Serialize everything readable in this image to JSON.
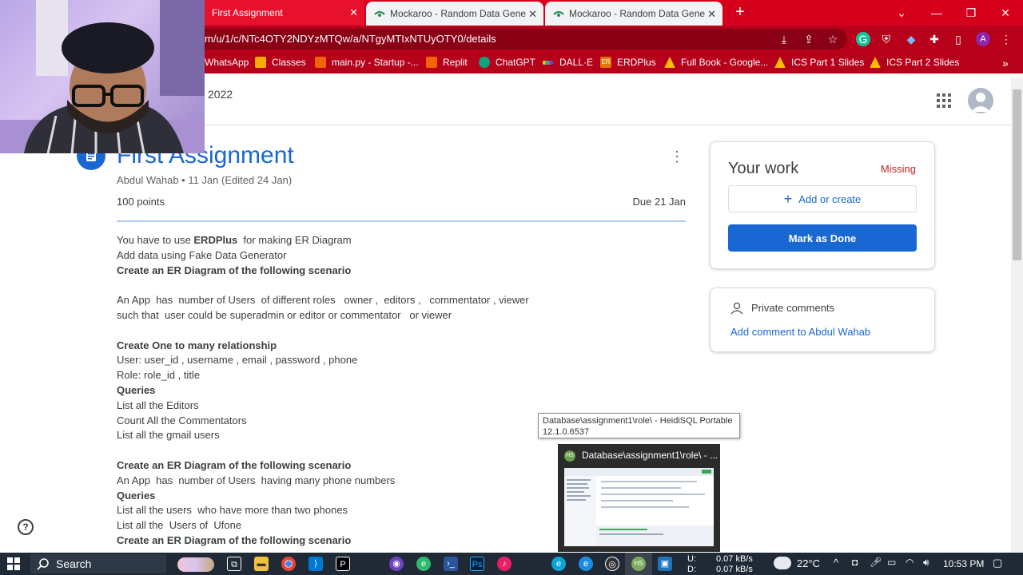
{
  "browser": {
    "tabs": [
      {
        "title": "First Assignment",
        "active": true
      },
      {
        "title": "Mockaroo - Random Data Gener",
        "active": false
      },
      {
        "title": "Mockaroo - Random Data Gener",
        "active": false
      }
    ],
    "new_tab": "+",
    "url": "m/u/1/c/NTc4OTY2NDYzMTQw/a/NTgyMTIxNTUyOTY0/details",
    "profile_initial": "A",
    "bookmarks": [
      {
        "label": "WhatsApp",
        "color": "#25d366"
      },
      {
        "label": "Classes",
        "color": "#f9ab00"
      },
      {
        "label": "main.py - Startup -...",
        "color": "#f26207"
      },
      {
        "label": "Replit",
        "color": "#f26207"
      },
      {
        "label": "ChatGPT",
        "color": "#10a37f"
      },
      {
        "label": "DALL·E",
        "color": "#ffd400"
      },
      {
        "label": "ERDPlus",
        "color": "#e37400"
      },
      {
        "label": "Full Book - Google...",
        "color": "#fbbc04"
      },
      {
        "label": "ICS Part 1 Slides",
        "color": "#fbbc04"
      },
      {
        "label": "ICS Part 2 Slides",
        "color": "#fbbc04"
      }
    ],
    "more_bookmarks": "»"
  },
  "classroom": {
    "class_name_fragment": "2022",
    "assignment": {
      "title": "First Assignment",
      "meta": "Abdul Wahab • 11 Jan (Edited 24 Jan)",
      "points": "100 points",
      "due": "Due 21 Jan",
      "description": [
        [
          {
            "t": "You have to use "
          },
          {
            "t": "ERDPlus",
            "b": true
          },
          {
            "t": "  for making ER Diagram"
          }
        ],
        [
          {
            "t": "Add data using Fake Data Generator"
          }
        ],
        [
          {
            "t": "Create an ER Diagram of the following scenario",
            "b": true
          }
        ],
        [
          {
            "t": ""
          }
        ],
        [
          {
            "t": "An App  has  number of Users  of different roles   owner ,  editors ,   commentator , viewer"
          }
        ],
        [
          {
            "t": "such that  user could be superadmin or editor or commentator   or viewer"
          }
        ],
        [
          {
            "t": ""
          }
        ],
        [
          {
            "t": "Create One to many relationship",
            "b": true
          }
        ],
        [
          {
            "t": "User: user_id , username , email , password , phone"
          }
        ],
        [
          {
            "t": "Role: role_id , title"
          }
        ],
        [
          {
            "t": "Queries",
            "b": true
          }
        ],
        [
          {
            "t": "List all the Editors"
          }
        ],
        [
          {
            "t": "Count All the Commentators"
          }
        ],
        [
          {
            "t": "List all the gmail users"
          }
        ],
        [
          {
            "t": ""
          }
        ],
        [
          {
            "t": "Create an ER Diagram of the following scenario",
            "b": true
          }
        ],
        [
          {
            "t": "An App  has  number of Users  having many phone numbers"
          }
        ],
        [
          {
            "t": "Queries",
            "b": true
          }
        ],
        [
          {
            "t": "List all the users  who have more than two phones"
          }
        ],
        [
          {
            "t": "List all the  Users of  Ufone"
          }
        ],
        [
          {
            "t": "Create an ER Diagram of the following scenario",
            "b": true
          }
        ]
      ]
    },
    "your_work": {
      "title": "Your work",
      "status": "Missing",
      "add_label": "Add or create",
      "mark_done_label": "Mark as Done"
    },
    "private_comments": {
      "title": "Private comments",
      "link": "Add comment to Abdul Wahab"
    }
  },
  "taskbar_popup": {
    "tooltip_line1": "Database\\assignment1\\role\\ - HeidiSQL Portable",
    "tooltip_line2": "12.1.0.6537",
    "preview_title": "Database\\assignment1\\role\\ - ..."
  },
  "taskbar": {
    "search_label": "Search",
    "net_up": "0.07 kB/s",
    "net_down": "0.07 kB/s",
    "drive_u": "U:",
    "drive_d": "D:",
    "temperature": "22°C",
    "time": "10:53 PM"
  },
  "colors": {
    "chrome_red": "#d6001c",
    "classroom_blue": "#1967d2",
    "missing_red": "#c5221f"
  }
}
